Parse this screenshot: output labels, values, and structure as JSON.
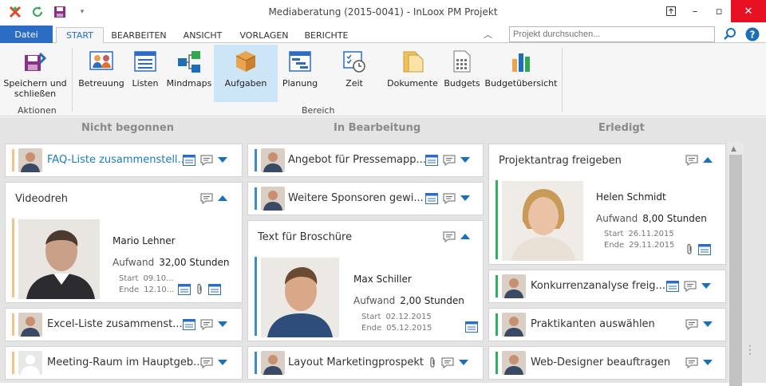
{
  "window": {
    "title": "Mediaberatung (2015-0041) - InLoox PM Projekt"
  },
  "ribbon_tabs": {
    "datei": "Datei",
    "start": "START",
    "bearbeiten": "BEARBEITEN",
    "ansicht": "ANSICHT",
    "vorlagen": "VORLAGEN",
    "berichte": "BERICHTE"
  },
  "search": {
    "placeholder": "Projekt durchsuchen..."
  },
  "ribbon": {
    "save_close": "Speichern und schließen",
    "betreuung": "Betreuung",
    "listen": "Listen",
    "mindmaps": "Mindmaps",
    "aufgaben": "Aufgaben",
    "planung": "Planung",
    "zeit": "Zeit",
    "dokumente": "Dokumente",
    "budgets": "Budgets",
    "budgetuebersicht": "Budgetübersicht",
    "group_aktionen": "Aktionen",
    "group_bereich": "Bereich"
  },
  "columns": {
    "not_started": "Nicht begonnen",
    "in_progress": "In Bearbeitung",
    "done": "Erledigt"
  },
  "labels": {
    "aufwand": "Aufwand",
    "start": "Start",
    "ende": "Ende"
  },
  "cards": {
    "faq": {
      "title": "FAQ-Liste zusammenstell..."
    },
    "videodreh": {
      "title": "Videodreh",
      "person": "Mario Lehner",
      "aufwand": "32,00 Stunden",
      "start": "09.10...",
      "ende": "12.10..."
    },
    "excel": {
      "title": "Excel-Liste zusammenst..."
    },
    "meeting": {
      "title": "Meeting-Raum im Hauptgeb..."
    },
    "angebot": {
      "title": "Angebot für Pressemapp..."
    },
    "sponsoren": {
      "title": "Weitere Sponsoren gewi..."
    },
    "broschuere": {
      "title": "Text für Broschüre",
      "person": "Max Schiller",
      "aufwand": "2,00 Stunden",
      "start": "02.12.2015",
      "ende": "05.12.2015"
    },
    "layout": {
      "title": "Layout Marketingprospekt"
    },
    "projektantrag": {
      "title": "Projektantrag freigeben",
      "person": "Helen Schmidt",
      "aufwand": "8,00 Stunden",
      "start": "26.11.2015",
      "ende": "29.11.2015"
    },
    "konkurrenz": {
      "title": "Konkurrenzanalyse freig..."
    },
    "praktikanten": {
      "title": "Praktikanten auswählen"
    },
    "webdesigner": {
      "title": "Web-Designer beauftragen"
    }
  },
  "colors": {
    "accent": "#2b6cc4",
    "orange_bar": "#f5c08a",
    "blue_bar": "#3b8ad6",
    "green_bar": "#2db35a",
    "selected_ribbon": "#cde6f7"
  }
}
